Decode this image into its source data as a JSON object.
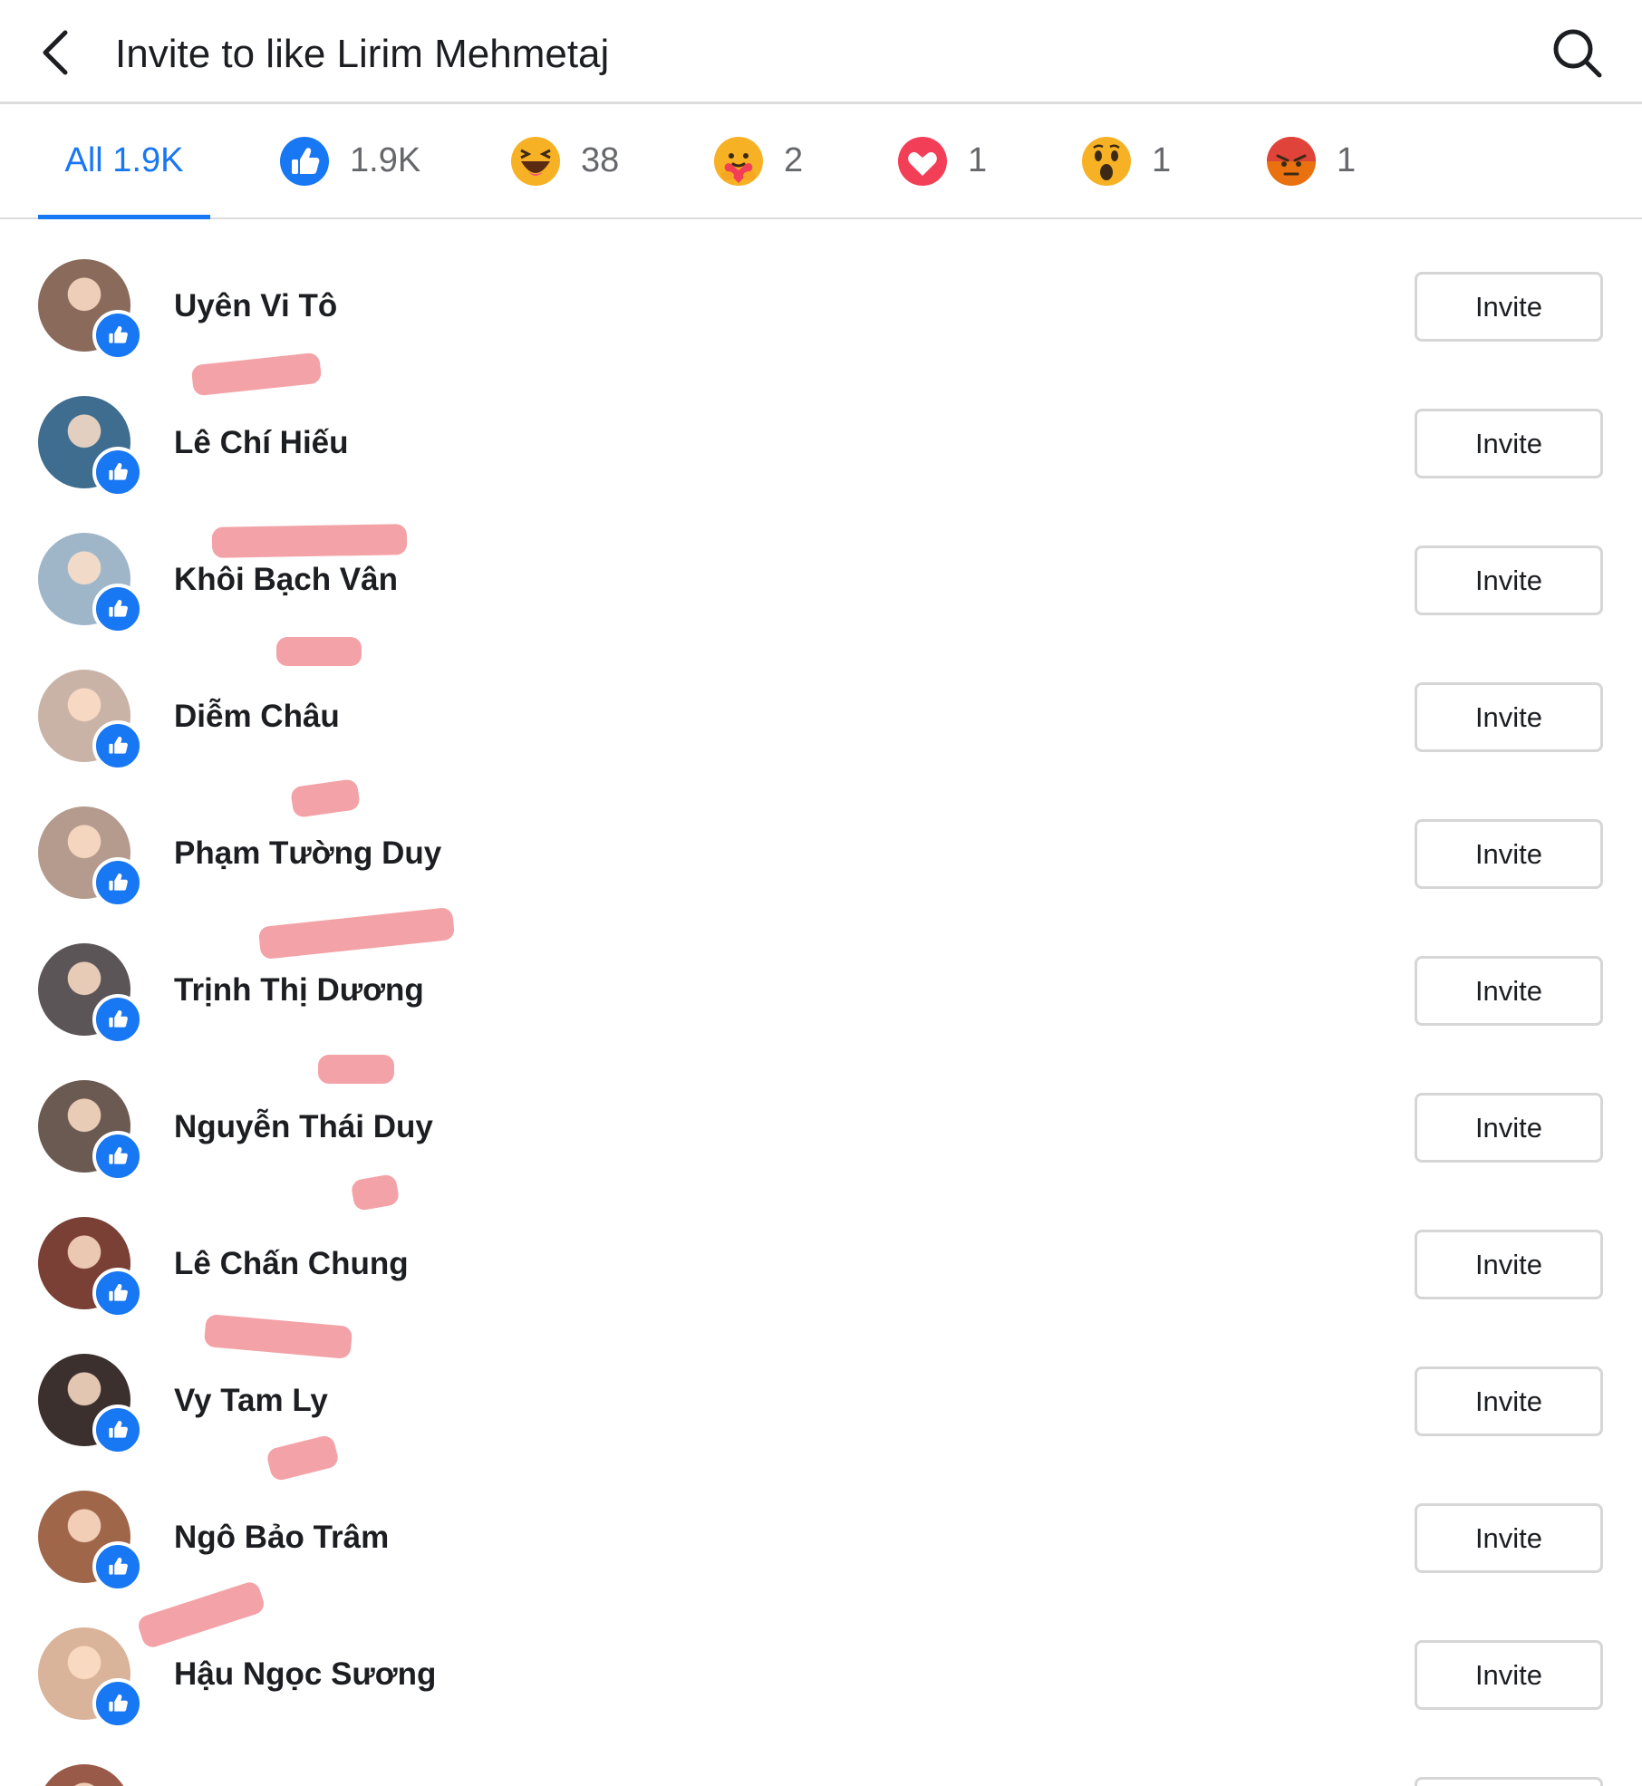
{
  "header": {
    "title": "Invite to like Lirim Mehmetaj"
  },
  "tabs": [
    {
      "label": "All 1.9K",
      "icon": "",
      "color": "#1877f2"
    },
    {
      "label": "1.9K",
      "icon": "like-reaction-icon",
      "color": "#1877f2"
    },
    {
      "label": "38",
      "icon": "haha-reaction-icon",
      "color": "#f7b125"
    },
    {
      "label": "2",
      "icon": "care-reaction-icon",
      "color": "#f7b125"
    },
    {
      "label": "1",
      "icon": "love-reaction-icon",
      "color": "#f33e58"
    },
    {
      "label": "1",
      "icon": "wow-reaction-icon",
      "color": "#f7b125"
    },
    {
      "label": "1",
      "icon": "angry-reaction-icon",
      "color": "#e9710f"
    }
  ],
  "people": [
    {
      "name": "Uyên Vi Tô",
      "button": "Invite",
      "avatar_color": "#8a6a5a"
    },
    {
      "name": "Lê Chí Hiếu",
      "button": "Invite",
      "avatar_color": "#3f6d8f"
    },
    {
      "name": "Khôi Bạch Vân",
      "button": "Invite",
      "avatar_color": "#9fb6c9"
    },
    {
      "name": "Diễm Châu",
      "button": "Invite",
      "avatar_color": "#c9b3a6"
    },
    {
      "name": "Phạm Tường Duy",
      "button": "Invite",
      "avatar_color": "#b59b8e"
    },
    {
      "name": "Trịnh Thị Dương",
      "button": "Invite",
      "avatar_color": "#5c5558"
    },
    {
      "name": "Nguyễn Thái Duy",
      "button": "Invite",
      "avatar_color": "#6b5a52"
    },
    {
      "name": "Lê Chấn Chung",
      "button": "Invite",
      "avatar_color": "#7a3f35"
    },
    {
      "name": "Vy Tam Ly",
      "button": "Invite",
      "avatar_color": "#3b302d"
    },
    {
      "name": "Ngô Bảo Trâm",
      "button": "Invite",
      "avatar_color": "#a0664a"
    },
    {
      "name": "Hậu Ngọc Sương",
      "button": "Invite",
      "avatar_color": "#d9b49a"
    }
  ],
  "colors": {
    "accent": "#1877f2",
    "redaction": "#f3a3a7"
  }
}
